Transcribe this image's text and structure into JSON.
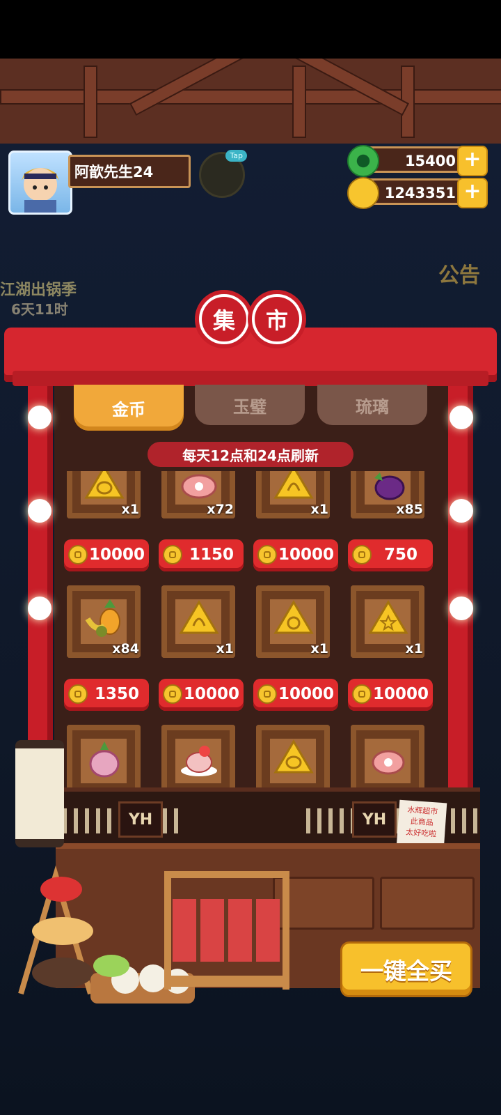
{
  "player": {
    "name": "阿歆先生24"
  },
  "tap_hint": "Tap",
  "currencies": [
    {
      "name": "jade",
      "value": "15400",
      "color": "#3bb34a"
    },
    {
      "name": "coin",
      "value": "1243351",
      "color": "#f7c52e"
    }
  ],
  "side_widgets": {
    "event_title": "江湖出锅季",
    "event_timer": "6天11时",
    "notice": "公告"
  },
  "market": {
    "title_chars": [
      "集",
      "市"
    ],
    "tabs": [
      {
        "label": "金币",
        "active": true
      },
      {
        "label": "玉璧",
        "active": false
      },
      {
        "label": "琉璃",
        "active": false
      }
    ],
    "refresh_note": "每天12点和24点刷新",
    "rows": [
      [
        {
          "icon": "gold-fish-token-icon",
          "qty": "x1",
          "price": "10000"
        },
        {
          "icon": "meat-icon",
          "qty": "x72",
          "price": "1150"
        },
        {
          "icon": "gold-spiral-token-icon",
          "qty": "x1",
          "price": "10000"
        },
        {
          "icon": "eggplant-icon",
          "qty": "x85",
          "price": "750"
        }
      ],
      [
        {
          "icon": "fruit-basket-icon",
          "qty": "x84",
          "price": "1350"
        },
        {
          "icon": "gold-spiral-token-icon",
          "qty": "x1",
          "price": "10000"
        },
        {
          "icon": "gold-shell-token-icon",
          "qty": "x1",
          "price": "10000"
        },
        {
          "icon": "gold-star-token-icon",
          "qty": "x1",
          "price": "10000"
        }
      ],
      [
        {
          "icon": "onion-icon"
        },
        {
          "icon": "chicken-dish-icon"
        },
        {
          "icon": "gold-fish-token-icon"
        },
        {
          "icon": "ham-icon"
        }
      ]
    ],
    "sign_label": "YH",
    "note_lines": [
      "水辉超市",
      "此商品",
      "太好吃啦"
    ],
    "buy_all_label": "一键全买"
  }
}
